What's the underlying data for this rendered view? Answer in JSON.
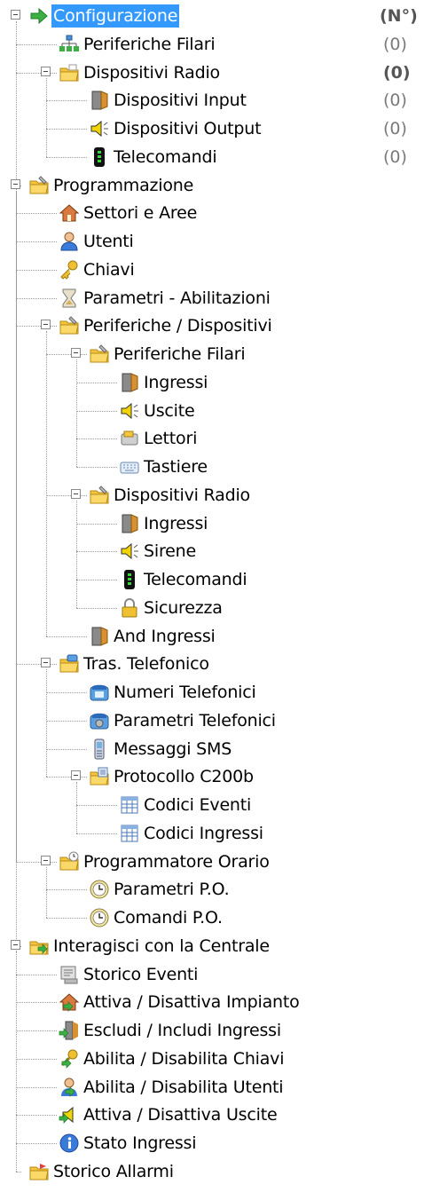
{
  "header": {
    "count_label": "(N°)"
  },
  "tree": [
    {
      "id": "configurazione",
      "label": "Configurazione",
      "level": 0,
      "icon": "green-arrow-icon",
      "expander": "collapse",
      "selected": true,
      "count": "(N°)",
      "count_head": true
    },
    {
      "id": "periferiche-filari",
      "label": "Periferiche Filari",
      "level": 1,
      "icon": "network-icon",
      "count": "(0)"
    },
    {
      "id": "dispositivi-radio",
      "label": "Dispositivi Radio",
      "level": 1,
      "icon": "folder-open-icon",
      "expander": "collapse",
      "count": "(0)",
      "count_bold": true
    },
    {
      "id": "dispositivi-input",
      "label": "Dispositivi Input",
      "level": 2,
      "icon": "door-icon",
      "count": "(0)"
    },
    {
      "id": "dispositivi-output",
      "label": "Dispositivi Output",
      "level": 2,
      "icon": "speaker-icon",
      "count": "(0)"
    },
    {
      "id": "telecomandi-cfg",
      "label": "Telecomandi",
      "level": 2,
      "icon": "remote-control-icon",
      "count": "(0)"
    },
    {
      "id": "programmazione",
      "label": "Programmazione",
      "level": 0,
      "icon": "folder-tools-icon",
      "expander": "collapse"
    },
    {
      "id": "settori-aree",
      "label": "Settori e Aree",
      "level": 1,
      "icon": "house-icon"
    },
    {
      "id": "utenti",
      "label": "Utenti",
      "level": 1,
      "icon": "user-icon"
    },
    {
      "id": "chiavi",
      "label": "Chiavi",
      "level": 1,
      "icon": "key-icon"
    },
    {
      "id": "parametri-abilitazioni",
      "label": "Parametri - Abilitazioni",
      "level": 1,
      "icon": "hourglass-icon"
    },
    {
      "id": "periferiche-dispositivi",
      "label": "Periferiche / Dispositivi",
      "level": 1,
      "icon": "folder-tools-icon",
      "expander": "collapse"
    },
    {
      "id": "prog-periferiche-filari",
      "label": "Periferiche Filari",
      "level": 2,
      "icon": "folder-tools-icon",
      "expander": "collapse"
    },
    {
      "id": "ingressi-filari",
      "label": "Ingressi",
      "level": 3,
      "icon": "door-icon"
    },
    {
      "id": "uscite",
      "label": "Uscite",
      "level": 3,
      "icon": "speaker-icon"
    },
    {
      "id": "lettori",
      "label": "Lettori",
      "level": 3,
      "icon": "reader-icon"
    },
    {
      "id": "tastiere",
      "label": "Tastiere",
      "level": 3,
      "icon": "keyboard-icon"
    },
    {
      "id": "prog-dispositivi-radio",
      "label": "Dispositivi Radio",
      "level": 2,
      "icon": "folder-tools-icon",
      "expander": "collapse"
    },
    {
      "id": "ingressi-radio",
      "label": "Ingressi",
      "level": 3,
      "icon": "door-icon"
    },
    {
      "id": "sirene",
      "label": "Sirene",
      "level": 3,
      "icon": "speaker-icon"
    },
    {
      "id": "telecomandi-prog",
      "label": "Telecomandi",
      "level": 3,
      "icon": "remote-control-icon"
    },
    {
      "id": "sicurezza",
      "label": "Sicurezza",
      "level": 3,
      "icon": "padlock-icon"
    },
    {
      "id": "and-ingressi",
      "label": "And Ingressi",
      "level": 2,
      "icon": "door-icon"
    },
    {
      "id": "tras-telefonico",
      "label": "Tras. Telefonico",
      "level": 1,
      "icon": "folder-phone-icon",
      "expander": "collapse"
    },
    {
      "id": "numeri-telefonici",
      "label": "Numeri Telefonici",
      "level": 2,
      "icon": "telephone-icon"
    },
    {
      "id": "parametri-telefonici",
      "label": "Parametri Telefonici",
      "level": 2,
      "icon": "telephone-settings-icon"
    },
    {
      "id": "messaggi-sms",
      "label": "Messaggi SMS",
      "level": 2,
      "icon": "mobile-phone-icon"
    },
    {
      "id": "protocollo-c200b",
      "label": "Protocollo C200b",
      "level": 2,
      "icon": "folder-document-icon",
      "expander": "collapse"
    },
    {
      "id": "codici-eventi",
      "label": "Codici Eventi",
      "level": 3,
      "icon": "table-icon"
    },
    {
      "id": "codici-ingressi",
      "label": "Codici Ingressi",
      "level": 3,
      "icon": "table-icon"
    },
    {
      "id": "programmatore-orario",
      "label": "Programmatore Orario",
      "level": 1,
      "icon": "folder-clock-icon",
      "expander": "collapse"
    },
    {
      "id": "parametri-po",
      "label": "Parametri P.O.",
      "level": 2,
      "icon": "clock-icon"
    },
    {
      "id": "comandi-po",
      "label": "Comandi P.O.",
      "level": 2,
      "icon": "clock-icon"
    },
    {
      "id": "interagisci",
      "label": "Interagisci con la Centrale",
      "level": 0,
      "icon": "folder-arrow-icon",
      "expander": "collapse"
    },
    {
      "id": "storico-eventi",
      "label": "Storico Eventi",
      "level": 1,
      "icon": "event-log-icon"
    },
    {
      "id": "attiva-impianto",
      "label": "Attiva / Disattiva Impianto",
      "level": 1,
      "icon": "house-arrow-icon"
    },
    {
      "id": "escludi-ingressi",
      "label": "Escludi / Includi Ingressi",
      "level": 1,
      "icon": "door-arrow-icon"
    },
    {
      "id": "abilita-chiavi",
      "label": "Abilita / Disabilita Chiavi",
      "level": 1,
      "icon": "key-arrow-icon"
    },
    {
      "id": "abilita-utenti",
      "label": "Abilita / Disabilita Utenti",
      "level": 1,
      "icon": "user-arrow-icon"
    },
    {
      "id": "attiva-uscite",
      "label": "Attiva / Disattiva Uscite",
      "level": 1,
      "icon": "speaker-arrow-icon"
    },
    {
      "id": "stato-ingressi",
      "label": "Stato Ingressi",
      "level": 1,
      "icon": "info-icon"
    },
    {
      "id": "storico-allarmi",
      "label": "Storico Allarmi",
      "level": 0,
      "icon": "folder-alarm-icon"
    }
  ],
  "colors": {
    "selection": "#3399ff",
    "tree_lines": "#9a9a9a",
    "count_text": "#7a7a7a",
    "folder": "#f5c542",
    "arrow": "#3cb043"
  }
}
